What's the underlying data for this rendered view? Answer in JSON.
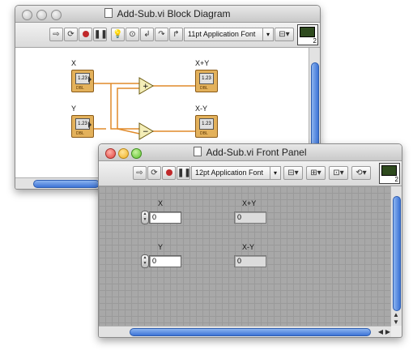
{
  "block_diagram": {
    "title": "Add-Sub.vi Block Diagram",
    "font": "11pt Application Font",
    "labels": {
      "x": "X",
      "y": "Y",
      "sum": "X+Y",
      "diff": "X-Y"
    },
    "numeric": "1.23",
    "dbl": "DBL",
    "add_symbol": "+",
    "sub_symbol": "−",
    "icon_number": "2"
  },
  "front_panel": {
    "title": "Add-Sub.vi Front Panel",
    "font": "12pt Application Font",
    "x_label": "X",
    "y_label": "Y",
    "sum_label": "X+Y",
    "diff_label": "X-Y",
    "x_value": "0",
    "y_value": "0",
    "sum_value": "0",
    "diff_value": "0",
    "icon_number": "2"
  },
  "colors": {
    "wire": "#e08a2a",
    "terminal": "#e3b15b",
    "scroll_thumb": "#3d74d6"
  }
}
